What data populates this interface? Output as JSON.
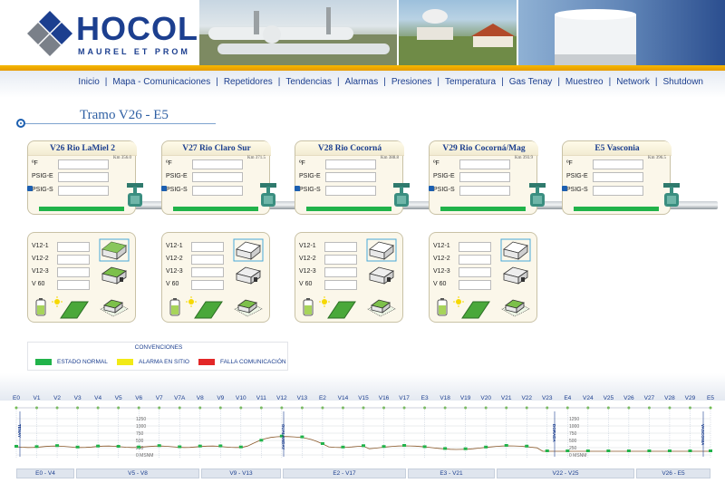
{
  "brand": {
    "name": "HOCOL",
    "tagline": "MAUREL ET PROM"
  },
  "nav": [
    "Inicio",
    "Mapa - Comunicaciones",
    "Repetidores",
    "Tendencias",
    "Alarmas",
    "Presiones",
    "Temperatura",
    "Gas Tenay",
    "Muestreo",
    "Network",
    "Shutdown"
  ],
  "page_title": "Tramo V26 - E5",
  "stations": [
    {
      "name": "V26 Rio LaMiel 2",
      "km": "Km 356.0"
    },
    {
      "name": "V27 Rio Claro Sur",
      "km": "Km 371.5"
    },
    {
      "name": "V28 Rio Cocorná",
      "km": "Km 388.8"
    },
    {
      "name": "V29 Rio Cocorná/Mag",
      "km": "Km 393.9"
    },
    {
      "name": "E5 Vasconia",
      "km": "Km 396.5"
    }
  ],
  "station_fields": [
    "ºF",
    "PSIG-E",
    "PSIG-S"
  ],
  "valve_fields": [
    "V12-1",
    "V12-2",
    "V12-3",
    "V 60"
  ],
  "legend": {
    "title": "CONVENCIONES",
    "items": [
      {
        "label": "ESTADO NORMAL",
        "color": "#21b34a"
      },
      {
        "label": "ALARMA EN SITIO",
        "color": "#f2ea16"
      },
      {
        "label": "FALLA COMUNICACIÓN",
        "color": "#e32727"
      }
    ]
  },
  "profile": {
    "stations": [
      "E0",
      "V1",
      "V2",
      "V3",
      "V4",
      "V5",
      "V6",
      "V7",
      "V7A",
      "V8",
      "V9",
      "V10",
      "V11",
      "V12",
      "V13",
      "E2",
      "V14",
      "V15",
      "V16",
      "V17",
      "E3",
      "V18",
      "V19",
      "V20",
      "V21",
      "V22",
      "V23",
      "E4",
      "V24",
      "V25",
      "V26",
      "V27",
      "V28",
      "V29",
      "E5"
    ],
    "vertical_labels": [
      "TENAY",
      "GUALANDAY",
      "DORADA",
      "VASCONIA"
    ],
    "elevations": [
      "1250",
      "1000",
      "750",
      "500",
      "250",
      "0 MSNM"
    ],
    "sections": [
      "E0 - V4",
      "V5 - V8",
      "V9 - V13",
      "E2 - V17",
      "E3 - V21",
      "V22 - V25",
      "V26 - E5"
    ]
  },
  "colors": {
    "brand_blue": "#1c3f8f",
    "accent_yellow": "#f5b800",
    "normal_green": "#21b34a"
  }
}
